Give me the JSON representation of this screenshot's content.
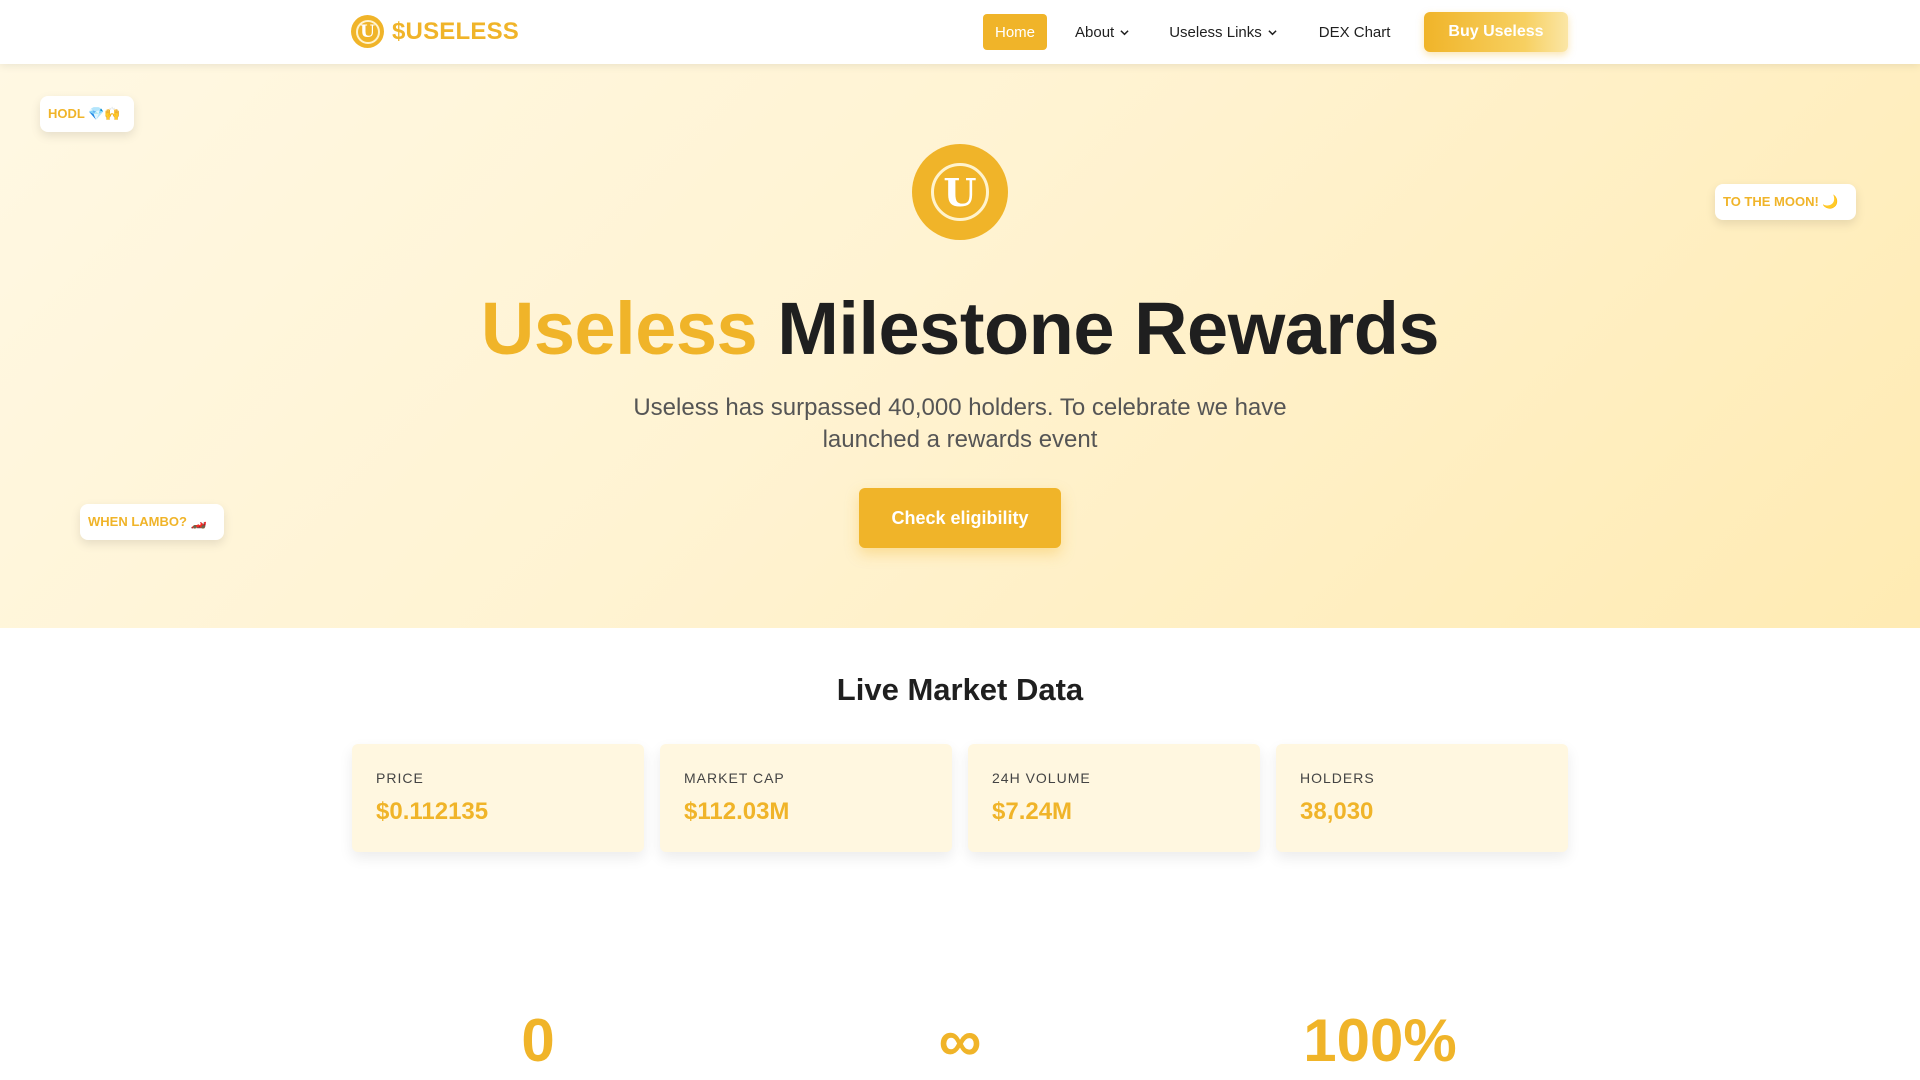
{
  "brand": {
    "name": "$USELESS",
    "coin_letter": "U"
  },
  "nav": {
    "home": "Home",
    "about": "About",
    "useless_links": "Useless Links",
    "dex_chart": "DEX Chart",
    "buy": "Buy Useless"
  },
  "stickers": {
    "hodl": "HODL 💎🙌",
    "moon": "TO THE MOON! 🌙",
    "lambo": "WHEN LAMBO? 🏎️"
  },
  "hero": {
    "coin_letter": "U",
    "title_accent": "Useless",
    "title_rest": "Milestone Rewards",
    "subtitle": "Useless has surpassed 40,000 holders. To celebrate we have launched a rewards event",
    "cta": "Check eligibility"
  },
  "market": {
    "title": "Live Market Data",
    "cards": [
      {
        "label": "PRICE",
        "value": "$0.112135"
      },
      {
        "label": "MARKET CAP",
        "value": "$112.03M"
      },
      {
        "label": "24H VOLUME",
        "value": "$7.24M"
      },
      {
        "label": "HOLDERS",
        "value": "38,030"
      }
    ]
  },
  "stats": [
    "0",
    "∞",
    "100%"
  ],
  "colors": {
    "accent": "#f0b429",
    "hero_bg": "#fff3d2",
    "card_bg": "#fff7e0",
    "text": "#1f1f1f"
  },
  "icons": {
    "dropdown": "chevron-down-icon",
    "logo": "coin-logo-icon"
  }
}
